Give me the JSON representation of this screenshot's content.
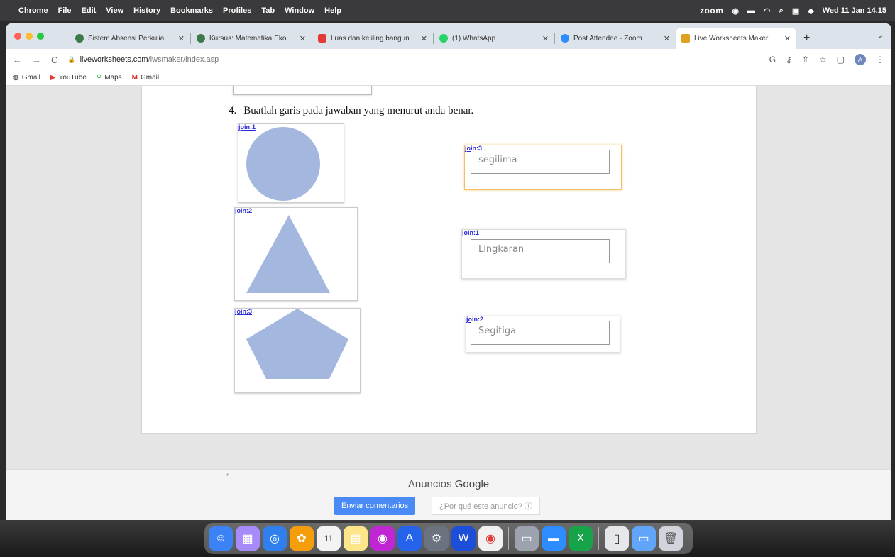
{
  "menubar": {
    "app_name": "Chrome",
    "menus": [
      "File",
      "Edit",
      "View",
      "History",
      "Bookmarks",
      "Profiles",
      "Tab",
      "Window",
      "Help"
    ],
    "zoom_label": "zoom",
    "datetime": "Wed 11 Jan 14.15"
  },
  "tabs": [
    {
      "title": "Sistem Absensi Perkulia",
      "color": "#3c7a4a"
    },
    {
      "title": "Kursus: Matematika Eko",
      "color": "#3c7a4a"
    },
    {
      "title": "Luas dan keliling bangun",
      "color": "#e53935"
    },
    {
      "title": "(1) WhatsApp",
      "color": "#25d366"
    },
    {
      "title": "Post Attendee - Zoom",
      "color": "#2d8cff"
    },
    {
      "title": "Live Worksheets Maker",
      "color": "#e0a020"
    }
  ],
  "address": {
    "host": "liveworksheets.com",
    "path": "/lwsmaker/index.asp"
  },
  "bookmarks": [
    {
      "label": "Gmail",
      "icon": "globe-icon"
    },
    {
      "label": "YouTube",
      "icon": "youtube-icon"
    },
    {
      "label": "Maps",
      "icon": "maps-icon"
    },
    {
      "label": "Gmail",
      "icon": "gmail-icon"
    }
  ],
  "worksheet": {
    "question_number": "4.",
    "question_text": "Buatlah garis pada jawaban yang menurut anda benar.",
    "shapes": [
      {
        "join": "join:1",
        "shape": "circle"
      },
      {
        "join": "join:2",
        "shape": "triangle"
      },
      {
        "join": "join:3",
        "shape": "pentagon"
      }
    ],
    "answers": [
      {
        "join": "join:3",
        "value": "segilima"
      },
      {
        "join": "join:1",
        "value": "Lingkaran"
      },
      {
        "join": "join:2",
        "value": "Segitiga"
      }
    ],
    "shape_color": "#a3b7df"
  },
  "ads": {
    "label_prefix": "Anuncios",
    "label_brand": "Google",
    "feedback_button": "Enviar comentarios",
    "why_button": "¿Por qué este anuncio? ⓘ"
  }
}
